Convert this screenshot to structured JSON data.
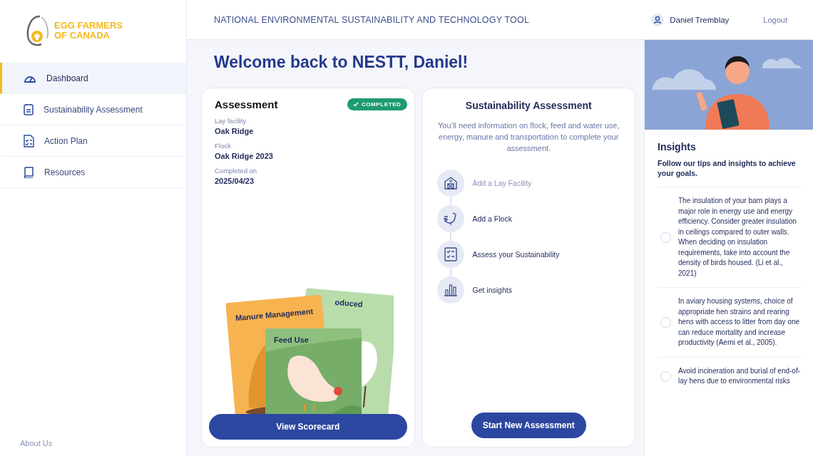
{
  "logo": {
    "line1": "EGG FARMERS",
    "line2": "OF CANADA"
  },
  "sidebar": {
    "items": [
      {
        "label": "Dashboard",
        "selected": true
      },
      {
        "label": "Sustainability Assessment",
        "selected": false
      },
      {
        "label": "Action Plan",
        "selected": false
      },
      {
        "label": "Resources",
        "selected": false
      }
    ],
    "footer_link": "About Us"
  },
  "header": {
    "title": "NATIONAL ENVIRONMENTAL SUSTAINABILITY AND TECHNOLOGY TOOL",
    "user": "Daniel Tremblay",
    "logout": "Logout"
  },
  "welcome": "Welcome back to NESTT, Daniel!",
  "assessment": {
    "title": "Assessment",
    "status": "COMPLETED",
    "fields": [
      {
        "label": "Lay facility",
        "value": "Oak Ridge"
      },
      {
        "label": "Flock",
        "value": "Oak Ridge 2023"
      },
      {
        "label": "Completed on",
        "value": "2025/04/23"
      }
    ],
    "cards": [
      "Manure Management",
      "oduced",
      "Feed Use"
    ],
    "button": "View Scorecard"
  },
  "sustainability": {
    "title": "Sustainability Assessment",
    "description": "You’ll need information on flock, feed and water use, energy, manure and transportation to complete your assessment.",
    "steps": [
      {
        "label": "Add a Lay Facility",
        "disabled": true
      },
      {
        "label": "Add a Flock",
        "disabled": false
      },
      {
        "label": "Assess your Sustainability",
        "disabled": false
      },
      {
        "label": "Get insights",
        "disabled": false
      }
    ],
    "button": "Start New Assessment"
  },
  "insights": {
    "title": "Insights",
    "subtitle": "Follow our tips and insights to achieve your goals.",
    "tips": [
      {
        "text": "The insulation of your barn plays a major role in energy use and energy efficiency. Consider greater insulation in ceilings compared to outer walls. When deciding on insulation requirements, take into account the density of birds housed. (Li et al., 2021)",
        "checked": false
      },
      {
        "text": "In aviary housing systems, choice of appropriate hen strains and rearing hens with access to litter from day one can reduce mortality and increase productivity (Aerni et al., 2005).",
        "checked": false
      },
      {
        "text": "Avoid incineration and burial of end-of-lay hens due to environmental risks",
        "checked": false
      }
    ]
  }
}
